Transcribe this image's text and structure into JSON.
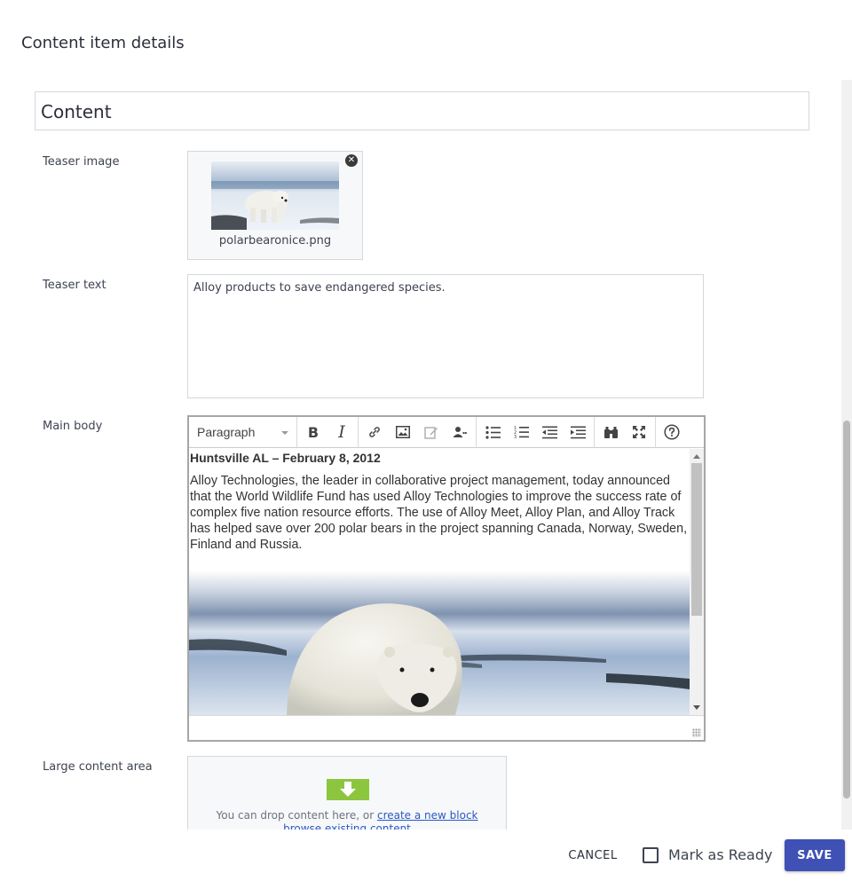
{
  "dialog": {
    "title": "Content item details"
  },
  "name_field": {
    "value": "Content"
  },
  "teaser_image": {
    "label": "Teaser image",
    "filename": "polarbearonice.png",
    "remove_icon": "close-circle-icon"
  },
  "teaser_text": {
    "label": "Teaser text",
    "value": "Alloy products to save endangered species."
  },
  "main_body": {
    "label": "Main body",
    "toolbar": {
      "format_select": "Paragraph",
      "buttons": [
        "bold",
        "italic",
        "link",
        "image",
        "edit",
        "personalize",
        "bulleted-list",
        "numbered-list",
        "outdent",
        "indent",
        "find",
        "fullscreen",
        "help"
      ]
    },
    "heading": "Huntsville AL – February 8, 2012",
    "paragraph": "Alloy Technologies, the leader in collaborative project management, today announced that the World Wildlife Fund has used Alloy Technologies to improve the success rate of complex five nation resource efforts. The use of Alloy Meet, Alloy Plan, and Alloy Track has helped save over 200 polar bears in the project spanning Canada, Norway, Sweden, Finland and Russia."
  },
  "large_content_area": {
    "label": "Large content area",
    "drop_text": "You can drop content here, or",
    "create_link": "create a new block",
    "browse_link": "browse existing content"
  },
  "footer": {
    "cancel_label": "CANCEL",
    "ready_label": "Mark as Ready",
    "ready_checked": false,
    "save_label": "SAVE"
  },
  "colors": {
    "primary": "#3f51b5",
    "drop_icon": "#8cc63f",
    "link": "#2b58c7"
  }
}
